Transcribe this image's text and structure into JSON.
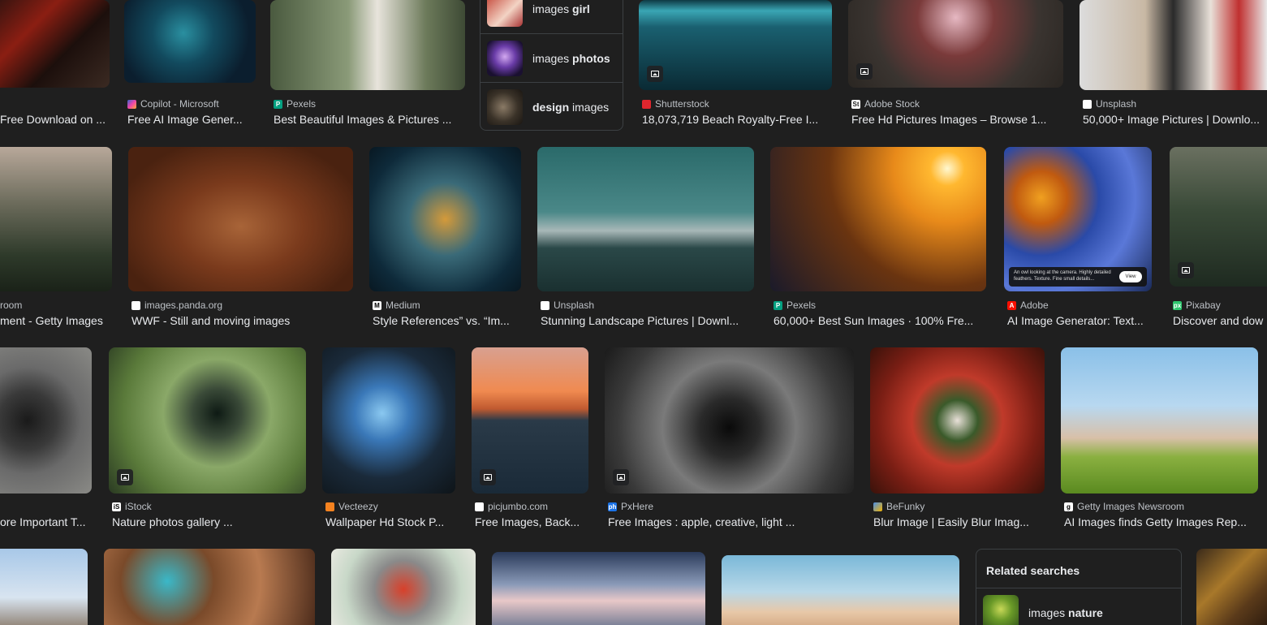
{
  "row1": [
    {
      "source": "",
      "title": "Free Download on ...",
      "favicon": "none"
    },
    {
      "source": "Copilot - Microsoft",
      "title": "Free AI Image Gener...",
      "favicon": "copilot-icon"
    },
    {
      "source": "Pexels",
      "title": "Best Beautiful Images & Pictures ...",
      "favicon": "pexels-icon"
    },
    {
      "source": "Shutterstock",
      "title": "18,073,719 Beach Royalty-Free I...",
      "favicon": "shutterstock-icon"
    },
    {
      "source": "Adobe Stock",
      "title": "Free Hd Pictures Images – Browse 1...",
      "favicon": "adobe-stock-icon"
    },
    {
      "source": "Unsplash",
      "title": "50,000+ Image Pictures | Downlo...",
      "favicon": "unsplash-icon"
    }
  ],
  "suggest_panel": {
    "items": [
      {
        "prefix": "images ",
        "bold": "girl",
        "suffix": ""
      },
      {
        "prefix": "images ",
        "bold": "photos",
        "suffix": ""
      },
      {
        "prefix": "",
        "bold": "design",
        "suffix": " images"
      }
    ]
  },
  "row2": [
    {
      "source": "room",
      "title": "ment - Getty Images"
    },
    {
      "source": "images.panda.org",
      "title": "WWF - Still and moving images"
    },
    {
      "source": "Medium",
      "title": "Style References” vs. “Im..."
    },
    {
      "source": "Unsplash",
      "title": "Stunning Landscape Pictures | Downl..."
    },
    {
      "source": "Pexels",
      "title": "60,000+ Best Sun Images · 100% Fre..."
    },
    {
      "source": "Adobe",
      "title": "AI Image Generator: Text..."
    },
    {
      "source": "Pixabay",
      "title": "Discover and dow"
    }
  ],
  "owl_popup": {
    "text": "An owl looking at the camera. Highly detailed feathers. Texture. Fine small details...",
    "button": "View"
  },
  "row3": [
    {
      "source": "",
      "title": "ore Important T..."
    },
    {
      "source": "iStock",
      "title": "Nature photos gallery ..."
    },
    {
      "source": "Vecteezy",
      "title": "Wallpaper Hd Stock P..."
    },
    {
      "source": "picjumbo.com",
      "title": "Free Images, Back..."
    },
    {
      "source": "PxHere",
      "title": "Free Images : apple, creative, light ..."
    },
    {
      "source": "BeFunky",
      "title": "Blur Image | Easily Blur Imag..."
    },
    {
      "source": "Getty Images Newsroom",
      "title": "AI Images finds Getty Images Rep..."
    }
  ],
  "related": {
    "heading": "Related searches",
    "items": [
      {
        "prefix": "images ",
        "bold": "nature"
      }
    ]
  }
}
